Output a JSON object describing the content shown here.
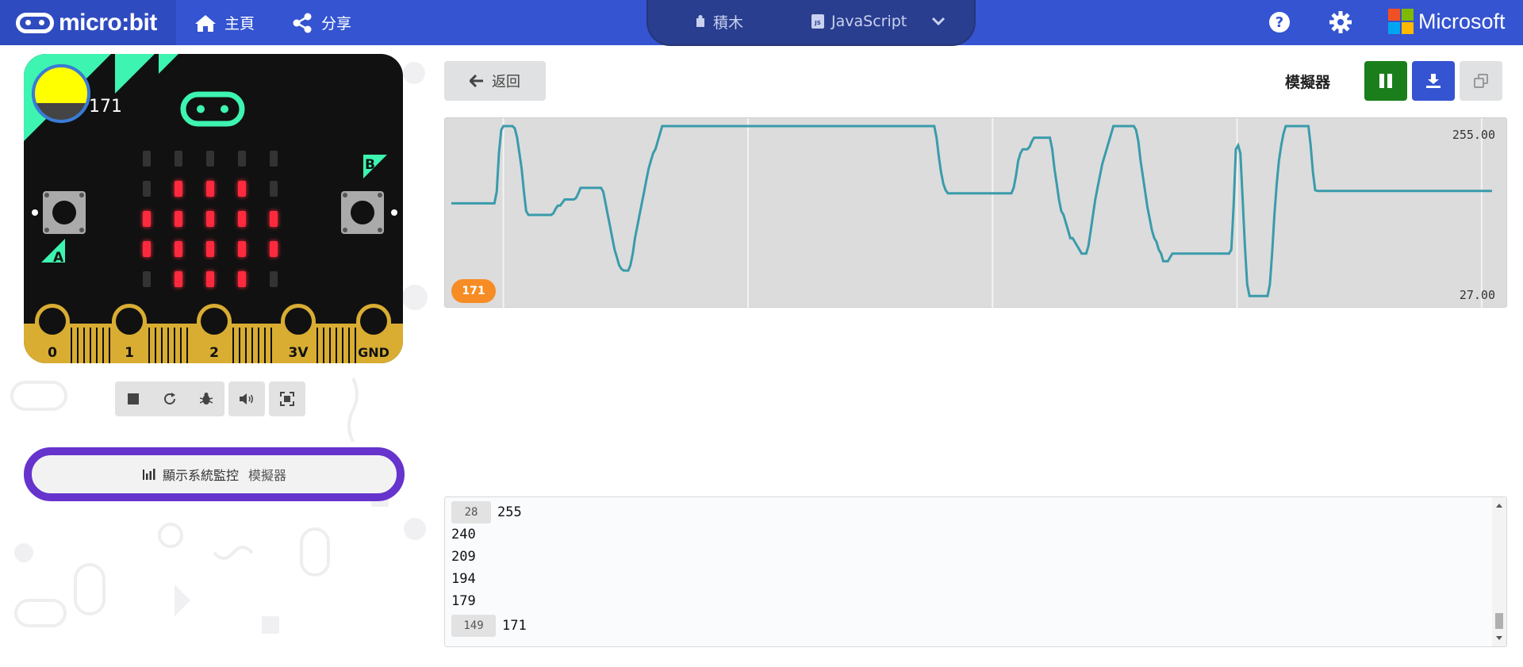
{
  "header": {
    "brand": "micro:bit",
    "nav": {
      "home_label": "主頁",
      "share_label": "分享"
    },
    "editor_toggle": {
      "blocks_label": "積木",
      "javascript_label": "JavaScript"
    },
    "microsoft_label": "Microsoft",
    "icons": [
      "home-icon",
      "share-icon",
      "puzzle-icon",
      "js-file-icon",
      "chevron-down-icon",
      "help-icon",
      "gear-icon",
      "microsoft-logo"
    ]
  },
  "simulator": {
    "light_level_value": "171",
    "button_a_label": "A",
    "button_b_label": "B",
    "pins": [
      "0",
      "1",
      "2",
      "3V",
      "GND"
    ],
    "led_grid": [
      [
        0,
        0,
        0,
        0,
        0
      ],
      [
        0,
        1,
        1,
        1,
        0
      ],
      [
        1,
        1,
        1,
        1,
        1
      ],
      [
        1,
        1,
        1,
        1,
        1
      ],
      [
        0,
        1,
        1,
        1,
        0
      ]
    ],
    "controls": [
      "stop-icon",
      "restart-icon",
      "debug-icon",
      "sound-icon",
      "fullscreen-icon"
    ],
    "console_button": {
      "label": "顯示系統監控",
      "sub_label": "模擬器"
    },
    "colors": {
      "board": "#111111",
      "gold": "#d8ad32",
      "led": "#ff2a3d",
      "accent_green": "#3df4b0",
      "light_yellow": "#ffff00"
    }
  },
  "toolbar": {
    "back_label": "返回",
    "title": "模擬器",
    "buttons": [
      "pause-icon",
      "download-icon",
      "copy-icon"
    ],
    "colors": {
      "pause": "#1a7f1a",
      "download": "#3454d1",
      "copy": "#e0e1e2"
    }
  },
  "chart": {
    "max_label": "255.00",
    "min_label": "27.00",
    "current_badge": "171",
    "line_color": "#3a9bab",
    "badge_color": "#f78c24"
  },
  "chart_data": {
    "type": "line",
    "title": "",
    "xlabel": "",
    "ylabel": "",
    "ylim": [
      27,
      255
    ],
    "series": [
      {
        "values": [
          155,
          155,
          155,
          155,
          155,
          155,
          155,
          155,
          155,
          155,
          155,
          155,
          155,
          155,
          155,
          155,
          155,
          155,
          155,
          155,
          170,
          220,
          250,
          255,
          255,
          255,
          255,
          255,
          252,
          240,
          220,
          200,
          170,
          145,
          140,
          140,
          140,
          140,
          140,
          140,
          140,
          140,
          140,
          140,
          140,
          142,
          148,
          152,
          152,
          156,
          160,
          160,
          160,
          160,
          160,
          162,
          168,
          175,
          175,
          175,
          175,
          175,
          175,
          175,
          175,
          175,
          175,
          170,
          155,
          140,
          125,
          110,
          95,
          85,
          75,
          70,
          68,
          68,
          68,
          75,
          90,
          110,
          125,
          140,
          155,
          170,
          185,
          200,
          210,
          220,
          225,
          235,
          245,
          255,
          255,
          255,
          255,
          255,
          255,
          255,
          255,
          255,
          255,
          255,
          255,
          255,
          255,
          255,
          255,
          255,
          255,
          255,
          255,
          255,
          255,
          255,
          255,
          255,
          255,
          255,
          255,
          255,
          255,
          255,
          255,
          255,
          255,
          255,
          255,
          255,
          255,
          255,
          255,
          255,
          255,
          255,
          255,
          255,
          255,
          255,
          255,
          255,
          255,
          255,
          255,
          255,
          255,
          255,
          255,
          255,
          255,
          255,
          255,
          255,
          255,
          255,
          255,
          255,
          255,
          255,
          255,
          255,
          255,
          255,
          255,
          255,
          255,
          255,
          255,
          255,
          255,
          255,
          255,
          255,
          255,
          255,
          255,
          255,
          255,
          255,
          255,
          255,
          255,
          255,
          255,
          255,
          255,
          255,
          255,
          255,
          255,
          255,
          255,
          255,
          255,
          255,
          255,
          255,
          255,
          255,
          255,
          255,
          255,
          255,
          255,
          255,
          255,
          255,
          255,
          255,
          255,
          255,
          255,
          255,
          240,
          215,
          195,
          180,
          172,
          168,
          168,
          168,
          168,
          168,
          168,
          168,
          168,
          168,
          168,
          168,
          168,
          168,
          168,
          168,
          168,
          168,
          168,
          168,
          168,
          168,
          168,
          168,
          168,
          168,
          168,
          168,
          168,
          168,
          175,
          190,
          210,
          220,
          225,
          225,
          225,
          228,
          235,
          240,
          240,
          240,
          240,
          240,
          240,
          240,
          240,
          225,
          200,
          180,
          160,
          145,
          140,
          130,
          120,
          110,
          110,
          105,
          100,
          95,
          90,
          90,
          90,
          100,
          120,
          140,
          160,
          175,
          190,
          205,
          215,
          225,
          235,
          245,
          255,
          255,
          255,
          255,
          255,
          255,
          255,
          255,
          255,
          255,
          250,
          235,
          210,
          190,
          170,
          150,
          135,
          120,
          110,
          105,
          95,
          90,
          80,
          80,
          80,
          85,
          90,
          90,
          90,
          90,
          90,
          90,
          90,
          90,
          90,
          90,
          90,
          90,
          90,
          90,
          90,
          90,
          90,
          90,
          90,
          90,
          90,
          90,
          90,
          90,
          90,
          90,
          95,
          150,
          225,
          230,
          220,
          160,
          100,
          50,
          35,
          35,
          35,
          35,
          35,
          35,
          35,
          35,
          35,
          50,
          90,
          140,
          180,
          210,
          230,
          245,
          255,
          255,
          255,
          255,
          255,
          255,
          255,
          255,
          255,
          255,
          255,
          230,
          195,
          172,
          171,
          171,
          171,
          171,
          171,
          171,
          171,
          171,
          171,
          171,
          171,
          171,
          171,
          171,
          171,
          171,
          171,
          171,
          171,
          171,
          171,
          171,
          171,
          171,
          171,
          171,
          171,
          171,
          171,
          171,
          171,
          171,
          171,
          171,
          171,
          171,
          171,
          171,
          171,
          171,
          171,
          171,
          171,
          171,
          171,
          171,
          171,
          171,
          171,
          171,
          171,
          171,
          171,
          171,
          171,
          171,
          171,
          171,
          171,
          171,
          171,
          171,
          171,
          171,
          171,
          171,
          171,
          171,
          171,
          171,
          171,
          171,
          171,
          171,
          171,
          171,
          171,
          171
        ]
      }
    ],
    "grid": true
  },
  "console": {
    "lines": [
      {
        "count": "28",
        "text": "255"
      },
      {
        "count": "",
        "text": "240"
      },
      {
        "count": "",
        "text": "209"
      },
      {
        "count": "",
        "text": "194"
      },
      {
        "count": "",
        "text": "179"
      },
      {
        "count": "149",
        "text": "171"
      }
    ]
  }
}
